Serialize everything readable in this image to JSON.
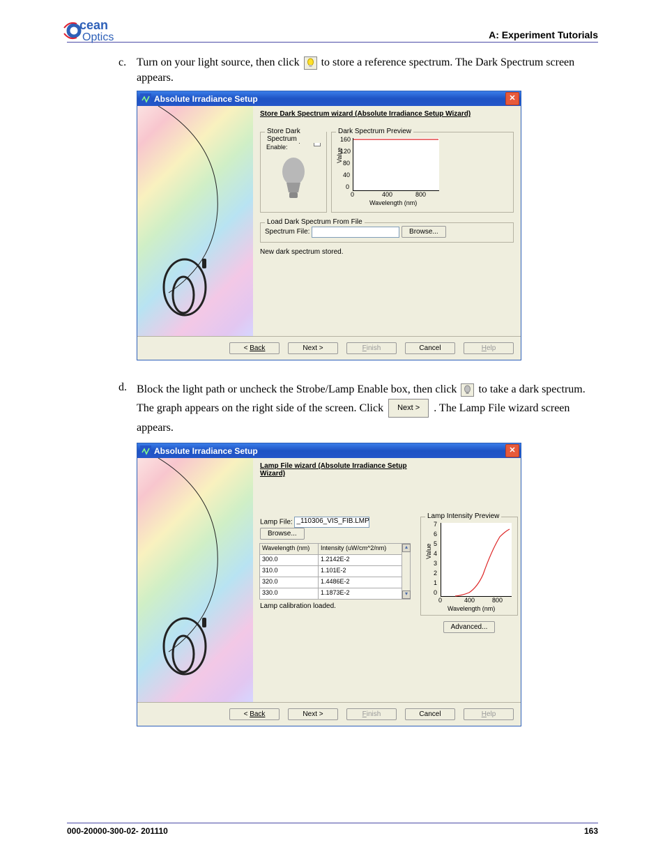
{
  "logo": {
    "line1": "cean",
    "line2": "Optics"
  },
  "section_header": "A: Experiment Tutorials",
  "steps": {
    "c": {
      "label": "c.",
      "text_before": "Turn on your light source, then click ",
      "text_after": " to store a reference spectrum. The Dark Spectrum screen appears."
    },
    "d": {
      "label": "d.",
      "t1": "Block the light path or uncheck the Strobe/Lamp Enable box, then click ",
      "t2": " to take a dark spectrum. The graph appears on the right side of the screen. Click ",
      "next_label": "Next >",
      "t3": ". The Lamp File wizard screen appears."
    }
  },
  "wiz1": {
    "title": "Absolute Irradiance Setup",
    "subtitle": "Store Dark Spectrum wizard (Absolute Irradiance Setup Wizard)",
    "sds_legend": "Store Dark Spectrum",
    "sds_label": "Strobe/Lamp Enable:",
    "preview_legend": "Dark Spectrum Preview",
    "load_legend": "Load Dark Spectrum From File",
    "spectrum_file_label": "Spectrum File:",
    "browse": "Browse...",
    "status": "New dark spectrum stored.",
    "buttons": {
      "back": "Back",
      "next": "Next >",
      "finish": "Finish",
      "cancel": "Cancel",
      "help": "Help"
    }
  },
  "wiz2": {
    "title": "Absolute Irradiance Setup",
    "subtitle": "Lamp File wizard (Absolute Irradiance Setup Wizard)",
    "lamp_file_label": "Lamp File:",
    "lamp_file_value": "_110306_VIS_FIB.LMP",
    "browse": "Browse...",
    "table": {
      "h1": "Wavelength (nm)",
      "h2": "Intensity (uW/cm^2/nm)",
      "rows": [
        {
          "w": "300.0",
          "i": "1.2142E-2"
        },
        {
          "w": "310.0",
          "i": "1.101E-2"
        },
        {
          "w": "320.0",
          "i": "1.4486E-2"
        },
        {
          "w": "330.0",
          "i": "1.1873E-2"
        }
      ]
    },
    "status": "Lamp calibration loaded.",
    "preview_legend": "Lamp Intensity Preview",
    "advanced": "Advanced...",
    "buttons": {
      "back": "Back",
      "next": "Next >",
      "finish": "Finish",
      "cancel": "Cancel",
      "help": "Help"
    }
  },
  "chart_data": [
    {
      "type": "line",
      "title": "Dark Spectrum Preview",
      "xlabel": "Wavelength (nm)",
      "ylabel": "Value",
      "xlim": [
        0,
        1000
      ],
      "ylim": [
        0,
        160
      ],
      "xticks": [
        0,
        400,
        800
      ],
      "yticks": [
        0,
        40,
        80,
        120,
        160
      ],
      "series": [
        {
          "name": "dark",
          "x": [
            0,
            1000
          ],
          "y": [
            160,
            160
          ]
        }
      ]
    },
    {
      "type": "line",
      "title": "Lamp Intensity Preview",
      "xlabel": "Wavelength (nm)",
      "ylabel": "Value",
      "xlim": [
        0,
        1000
      ],
      "ylim": [
        0,
        7
      ],
      "xticks": [
        0,
        400,
        800
      ],
      "yticks": [
        0,
        1,
        2,
        3,
        4,
        5,
        6,
        7
      ],
      "series": [
        {
          "name": "lamp",
          "x": [
            300,
            400,
            500,
            600,
            700,
            800,
            900
          ],
          "y": [
            0.05,
            0.2,
            0.8,
            2.2,
            4.0,
            5.5,
            6.3
          ]
        }
      ]
    }
  ],
  "footer": {
    "docnum": "000-20000-300-02- 201110",
    "page": "163"
  }
}
